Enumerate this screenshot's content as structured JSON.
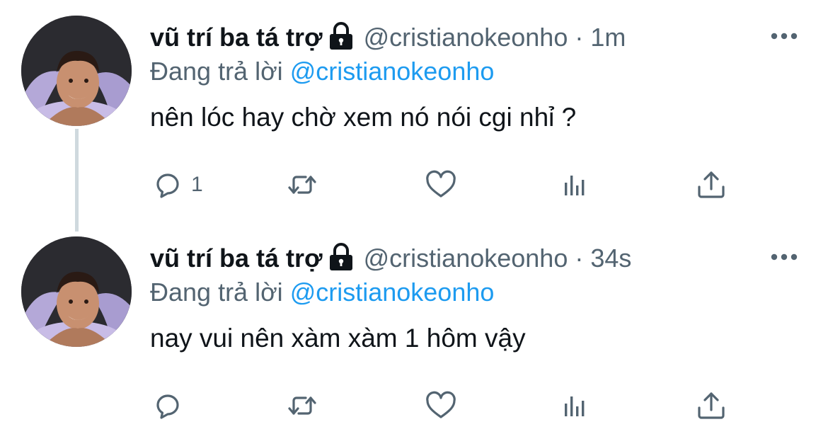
{
  "tweets": [
    {
      "display_name": "vũ trí ba tá trợ",
      "handle": "@cristianokeonho",
      "separator": "·",
      "timestamp": "1m",
      "reply_prefix": "Đang trả lời",
      "reply_to": "@cristianokeonho",
      "text": "nên lóc hay chờ xem nó nói cgi nhỉ ?",
      "reply_count": "1",
      "protected": true
    },
    {
      "display_name": "vũ trí ba tá trợ",
      "handle": "@cristianokeonho",
      "separator": "·",
      "timestamp": "34s",
      "reply_prefix": "Đang trả lời",
      "reply_to": "@cristianokeonho",
      "text": "nay vui nên xàm xàm 1 hôm vậy",
      "reply_count": "",
      "protected": true
    }
  ],
  "icons": {
    "lock": "lock-icon",
    "more": "more-icon",
    "reply": "reply-icon",
    "retweet": "retweet-icon",
    "like": "like-icon",
    "views": "views-icon",
    "share": "share-icon"
  },
  "colors": {
    "text": "#0f1419",
    "secondary": "#536471",
    "link": "#1d9bf0",
    "thread_line": "#cfd9de",
    "background": "#ffffff"
  }
}
